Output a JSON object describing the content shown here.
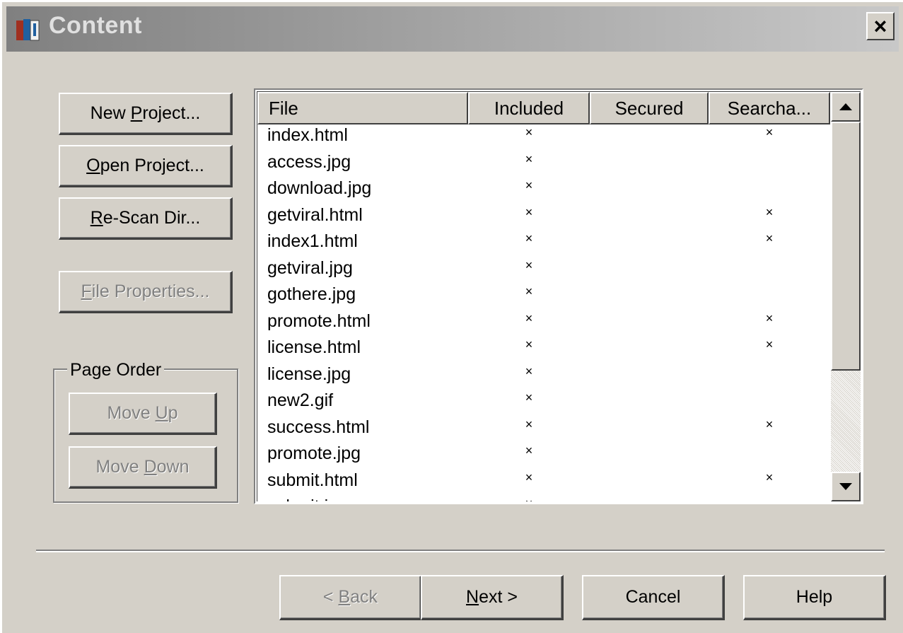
{
  "window": {
    "title": "Content",
    "close_label": "×"
  },
  "left_buttons": {
    "new_project": {
      "pre": "New ",
      "key": "P",
      "post": "roject..."
    },
    "open_project": {
      "pre": "",
      "key": "O",
      "post": "pen Project..."
    },
    "rescan_dir": {
      "pre": "",
      "key": "R",
      "post": "e-Scan Dir..."
    },
    "file_properties": {
      "pre": "",
      "key": "F",
      "post": "ile Properties..."
    }
  },
  "page_order": {
    "label": "Page Order",
    "move_up": {
      "pre": "Move ",
      "key": "U",
      "post": "p"
    },
    "move_down": {
      "pre": "Move ",
      "key": "D",
      "post": "own"
    }
  },
  "file_list": {
    "columns": [
      "File",
      "Included",
      "Secured",
      "Searcha..."
    ],
    "rows": [
      {
        "file": "index.html",
        "included": "×",
        "secured": "",
        "searchable": "×"
      },
      {
        "file": "access.jpg",
        "included": "×",
        "secured": "",
        "searchable": ""
      },
      {
        "file": "download.jpg",
        "included": "×",
        "secured": "",
        "searchable": ""
      },
      {
        "file": "getviral.html",
        "included": "×",
        "secured": "",
        "searchable": "×"
      },
      {
        "file": "index1.html",
        "included": "×",
        "secured": "",
        "searchable": "×"
      },
      {
        "file": "getviral.jpg",
        "included": "×",
        "secured": "",
        "searchable": ""
      },
      {
        "file": "gothere.jpg",
        "included": "×",
        "secured": "",
        "searchable": ""
      },
      {
        "file": "promote.html",
        "included": "×",
        "secured": "",
        "searchable": "×"
      },
      {
        "file": "license.html",
        "included": "×",
        "secured": "",
        "searchable": "×"
      },
      {
        "file": "license.jpg",
        "included": "×",
        "secured": "",
        "searchable": ""
      },
      {
        "file": "new2.gif",
        "included": "×",
        "secured": "",
        "searchable": ""
      },
      {
        "file": "success.html",
        "included": "×",
        "secured": "",
        "searchable": "×"
      },
      {
        "file": "promote.jpg",
        "included": "×",
        "secured": "",
        "searchable": ""
      },
      {
        "file": "submit.html",
        "included": "×",
        "secured": "",
        "searchable": "×"
      },
      {
        "file": "submit.jpg",
        "included": "×",
        "secured": "",
        "searchable": ""
      }
    ]
  },
  "footer": {
    "back": {
      "pre": "< ",
      "key": "B",
      "post": "ack"
    },
    "next": {
      "pre": "",
      "key": "N",
      "post": "ext >"
    },
    "cancel": "Cancel",
    "help": "Help"
  },
  "icons": {
    "app": "book-icon",
    "scroll_up": "scroll-up-arrow-icon",
    "scroll_down": "scroll-down-arrow-icon"
  }
}
